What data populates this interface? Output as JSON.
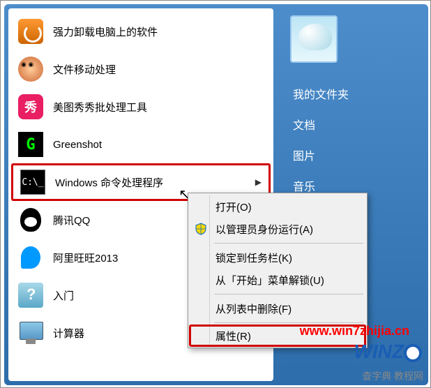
{
  "left_menu": [
    {
      "id": "uninstall",
      "label": "强力卸载电脑上的软件"
    },
    {
      "id": "filemove",
      "label": "文件移动处理"
    },
    {
      "id": "meitu",
      "label": "美图秀秀批处理工具"
    },
    {
      "id": "greenshot",
      "label": "Greenshot"
    },
    {
      "id": "cmd",
      "label": "Windows 命令处理程序",
      "selected": true,
      "has_expand": true
    },
    {
      "id": "qq",
      "label": "腾讯QQ"
    },
    {
      "id": "wangwang",
      "label": "阿里旺旺2013"
    },
    {
      "id": "gettingstarted",
      "label": "入门"
    },
    {
      "id": "computer",
      "label": "计算器"
    }
  ],
  "right_menu": [
    {
      "id": "myfiles",
      "label": "我的文件夹"
    },
    {
      "id": "documents",
      "label": "文档"
    },
    {
      "id": "pictures",
      "label": "图片"
    },
    {
      "id": "music",
      "label": "音乐"
    }
  ],
  "context_menu": [
    {
      "id": "open",
      "label": "打开(O)"
    },
    {
      "id": "runas",
      "label": "以管理员身份运行(A)",
      "shield": true
    },
    {
      "sep": true
    },
    {
      "id": "pin",
      "label": "锁定到任务栏(K)"
    },
    {
      "id": "unpin",
      "label": "从「开始」菜单解锁(U)"
    },
    {
      "sep": true
    },
    {
      "id": "remove",
      "label": "从列表中删除(F)"
    },
    {
      "sep": true
    },
    {
      "id": "properties",
      "label": "属性(R)",
      "highlighted": true
    }
  ],
  "watermarks": {
    "url": "www.win7zhijia.cn",
    "logo_text": "WINZ",
    "footer": "查字典 教程网"
  },
  "meitu_glyph": "秀"
}
